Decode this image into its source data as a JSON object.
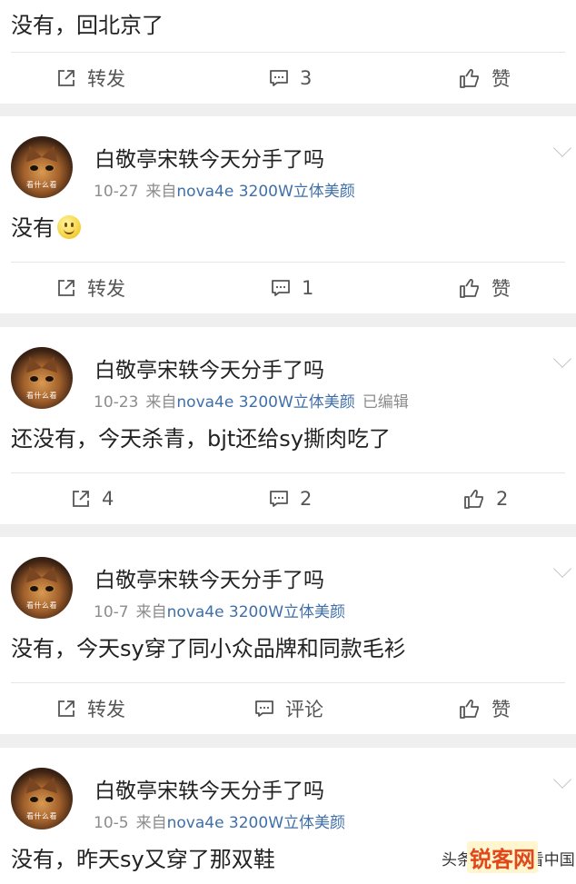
{
  "first_post": {
    "content": "没有，回北京了",
    "actions": {
      "repost": "转发",
      "comment": "3",
      "like": "赞"
    }
  },
  "posts": [
    {
      "username": "白敬亭宋轶今天分手了吗",
      "avatar_caption": "看什么看",
      "date": "10-27",
      "from": "来自",
      "source": "nova4e 3200W立体美颜",
      "edited": "",
      "content": "没有",
      "emoji": "smiley-emoji",
      "actions": {
        "repost": "转发",
        "comment": "1",
        "like": "赞"
      }
    },
    {
      "username": "白敬亭宋轶今天分手了吗",
      "avatar_caption": "看什么看",
      "date": "10-23",
      "from": "来自",
      "source": "nova4e 3200W立体美颜",
      "edited": "已编辑",
      "content": "还没有，今天杀青，bjt还给sy撕肉吃了",
      "actions": {
        "repost": "4",
        "comment": "2",
        "like": "2"
      }
    },
    {
      "username": "白敬亭宋轶今天分手了吗",
      "avatar_caption": "看什么看",
      "date": "10-7",
      "from": "来自",
      "source": "nova4e 3200W立体美颜",
      "edited": "",
      "content": "没有，今天sy穿了同小众品牌和同款毛衫",
      "actions": {
        "repost": "转发",
        "comment": "评论",
        "like": "赞"
      }
    },
    {
      "username": "白敬亭宋轶今天分手了吗",
      "avatar_caption": "看什么看",
      "date": "10-5",
      "from": "来自",
      "source": "nova4e 3200W立体美颜",
      "edited": "",
      "content": "没有，昨天sy又穿了那双鞋"
    }
  ],
  "watermark": {
    "text": "头条 @ 主播看中国",
    "logo": "锐客网"
  },
  "colors": {
    "link": "#3f6fa8",
    "meta": "#8c8c8c",
    "separator": "#efefef"
  },
  "icons": {
    "repost": "share-icon",
    "comment": "comment-icon",
    "like": "thumbs-up-icon",
    "menu": "chevron-down-icon"
  }
}
